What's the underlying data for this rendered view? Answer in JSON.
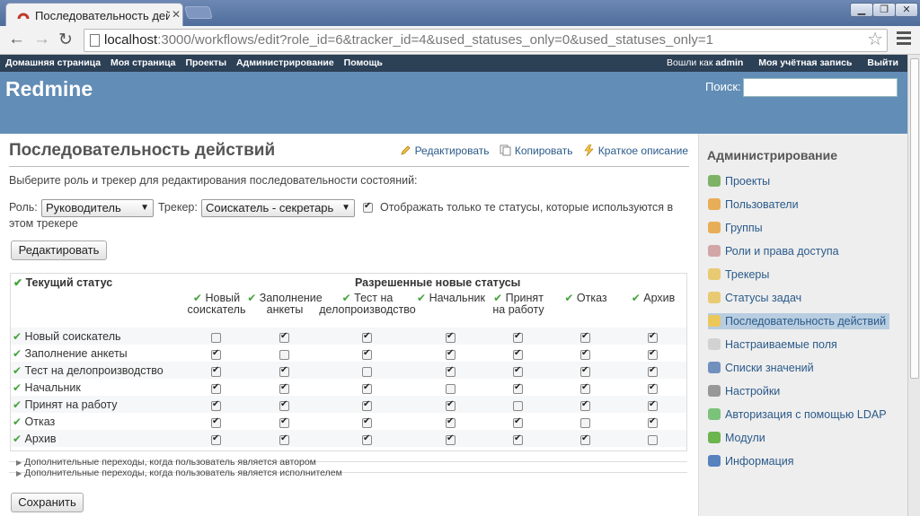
{
  "browser": {
    "tab_title": "Последовательность дей",
    "url_host": "localhost",
    "url_path": ":3000/workflows/edit?role_id=6&tracker_id=4&used_statuses_only=0&used_statuses_only=1"
  },
  "top_menu": {
    "items": [
      "Домашняя страница",
      "Моя страница",
      "Проекты",
      "Администрирование",
      "Помощь"
    ],
    "logged_as": "Вошли как",
    "user": "admin",
    "my_account": "Моя учётная запись",
    "logout": "Выйти"
  },
  "header": {
    "title": "Redmine",
    "search_label": "Поиск:"
  },
  "page": {
    "title": "Последовательность действий",
    "actions": [
      "Редактировать",
      "Копировать",
      "Краткое описание"
    ],
    "intro": "Выберите роль и трекер для редактирования последовательности состояний:",
    "role_label": "Роль:",
    "role_value": "Руководитель",
    "tracker_label": "Трекер:",
    "tracker_value": "Соискатель - секретарь",
    "only_used_label_1": "Отображать только те статусы, которые используются в",
    "only_used_label_2": "этом трекере",
    "only_used_checked": true,
    "edit_button": "Редактировать",
    "save_button": "Сохранить"
  },
  "grid": {
    "current_status_header": "Текущий статус",
    "allowed_header": "Разрешенные новые статусы",
    "columns": [
      [
        "Новый",
        "соискатель"
      ],
      [
        "Заполнение",
        "анкеты"
      ],
      [
        "Тест на",
        "делопроизводство"
      ],
      [
        "Начальник"
      ],
      [
        "Принят",
        "на работу"
      ],
      [
        "Отказ"
      ],
      [
        "Архив"
      ]
    ],
    "rows": [
      {
        "label": "Новый соискатель",
        "checks": [
          false,
          true,
          true,
          true,
          true,
          true,
          true
        ]
      },
      {
        "label": "Заполнение анкеты",
        "checks": [
          true,
          false,
          true,
          true,
          true,
          true,
          true
        ]
      },
      {
        "label": "Тест на делопроизводство",
        "checks": [
          true,
          true,
          false,
          true,
          true,
          true,
          true
        ]
      },
      {
        "label": "Начальник",
        "checks": [
          true,
          true,
          true,
          false,
          true,
          true,
          true
        ]
      },
      {
        "label": "Принят на работу",
        "checks": [
          true,
          true,
          true,
          true,
          false,
          true,
          true
        ]
      },
      {
        "label": "Отказ",
        "checks": [
          true,
          true,
          true,
          true,
          true,
          false,
          true
        ]
      },
      {
        "label": "Архив",
        "checks": [
          true,
          true,
          true,
          true,
          true,
          true,
          false
        ]
      }
    ],
    "author_transitions": "Дополнительные переходы, когда пользователь является автором",
    "assignee_transitions": "Дополнительные переходы, когда пользователь является исполнителем"
  },
  "sidebar": {
    "title": "Администрирование",
    "items": [
      {
        "label": "Проекты",
        "icon": "projects-icon"
      },
      {
        "label": "Пользователи",
        "icon": "users-icon"
      },
      {
        "label": "Группы",
        "icon": "groups-icon"
      },
      {
        "label": "Роли и права доступа",
        "icon": "roles-icon"
      },
      {
        "label": "Трекеры",
        "icon": "trackers-icon"
      },
      {
        "label": "Статусы задач",
        "icon": "statuses-icon"
      },
      {
        "label": "Последовательность действий",
        "icon": "workflow-icon",
        "selected": true
      },
      {
        "label": "Настраиваемые поля",
        "icon": "custom-fields-icon"
      },
      {
        "label": "Списки значений",
        "icon": "enumerations-icon"
      },
      {
        "label": "Настройки",
        "icon": "settings-icon"
      },
      {
        "label": "Авторизация с помощью LDAP",
        "icon": "ldap-icon"
      },
      {
        "label": "Модули",
        "icon": "plugins-icon"
      },
      {
        "label": "Информация",
        "icon": "info-icon"
      }
    ]
  },
  "colors": {
    "header": "#628db6",
    "top_menu": "#2c4056",
    "link": "#2a5a8a",
    "check": "#44a33b",
    "selected": "#b8cde0"
  }
}
